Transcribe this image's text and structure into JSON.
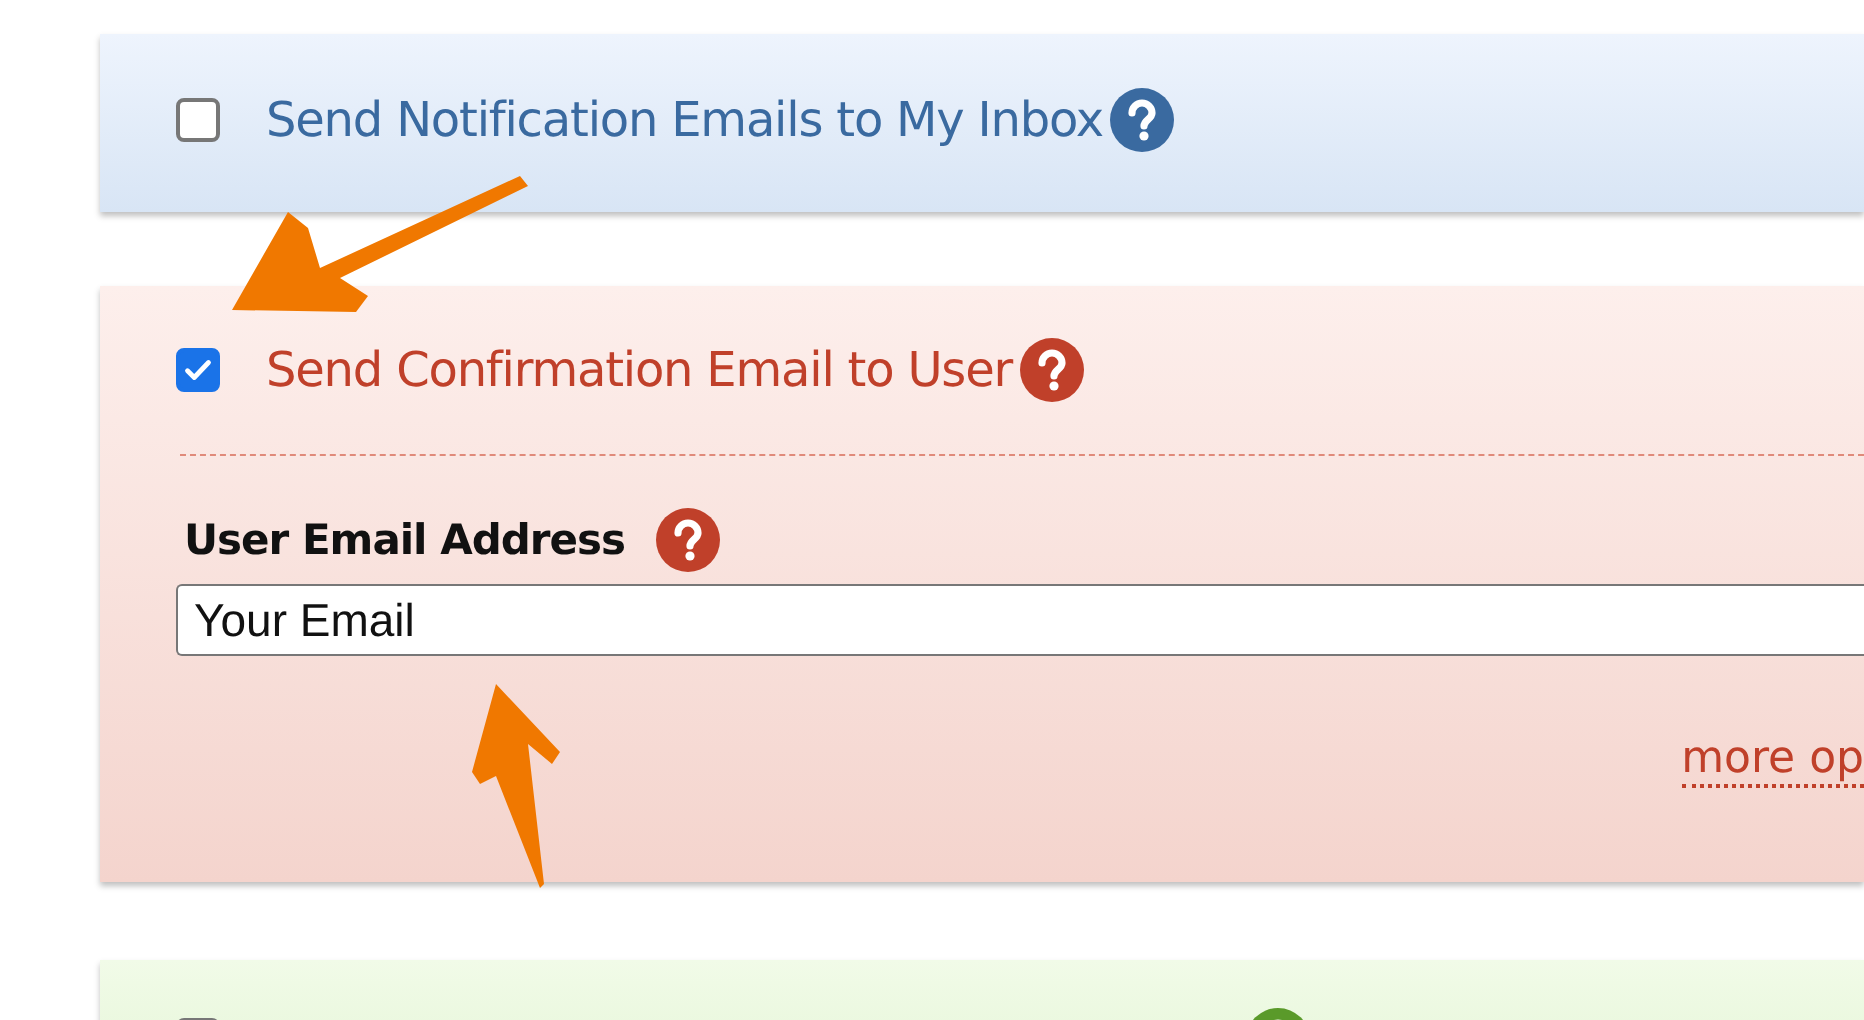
{
  "sections": [
    {
      "kind": "notification",
      "label": "Send Notification Emails to My Inbox",
      "checked": false
    },
    {
      "kind": "confirmation",
      "label": "Send Confirmation Email to User",
      "checked": true,
      "field": {
        "label": "User Email Address",
        "value": "Your Email"
      },
      "link": "more op"
    },
    {
      "kind": "success",
      "checked": false
    }
  ]
}
